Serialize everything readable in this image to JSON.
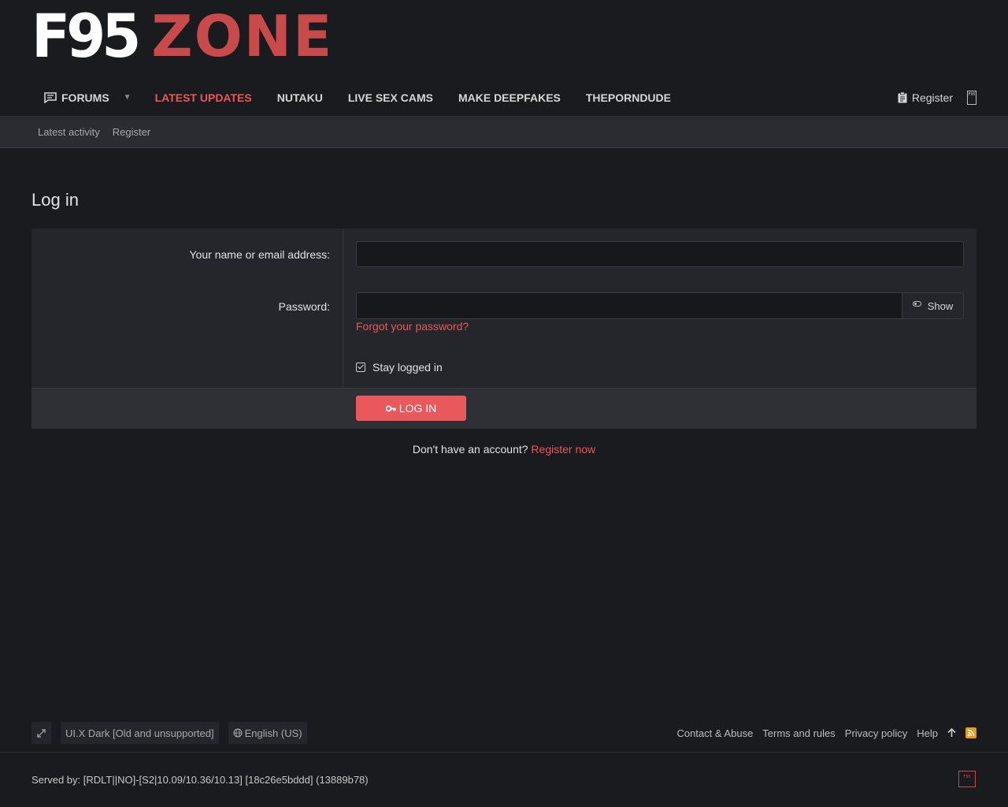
{
  "logo": {
    "part1": "F95",
    "part2": "ZONE"
  },
  "nav": {
    "items": [
      {
        "label": "FORUMS"
      },
      {
        "label": "LATEST UPDATES"
      },
      {
        "label": "NUTAKU"
      },
      {
        "label": "LIVE SEX CAMS"
      },
      {
        "label": "MAKE DEEPFAKES"
      },
      {
        "label": "THEPORNDUDE"
      }
    ],
    "register": "Register",
    "mini_logo": "F95"
  },
  "subnav": {
    "latest_activity": "Latest activity",
    "register": "Register"
  },
  "page": {
    "title": "Log in"
  },
  "form": {
    "name_label": "Your name or email address:",
    "name_value": "",
    "password_label": "Password:",
    "password_value": "",
    "show_label": "Show",
    "forgot": "Forgot your password?",
    "stay_logged_in": "Stay logged in",
    "submit": "LOG IN"
  },
  "register_prompt": {
    "text": "Don't have an account?",
    "link": "Register now"
  },
  "footer": {
    "style_chooser": "UI.X Dark [Old and unsupported]",
    "language": "English (US)",
    "links": [
      "Contact & Abuse",
      "Terms and rules",
      "Privacy policy",
      "Help"
    ],
    "served_by": "Served by: [RDLT||NO]-[S2|10.09/10.36/10.13] [18c26e5bddd] (13889b78)",
    "served_logo": "F95"
  },
  "colors": {
    "accent": "#e9585a",
    "background": "#1a1b1f",
    "panel": "#25262b",
    "rss": "#e89b17"
  },
  "icons": [
    "forums-icon",
    "register-clipboard-icon",
    "toggle-icon",
    "key-icon",
    "expand-icon",
    "globe-icon",
    "arrow-up-icon",
    "rss-icon"
  ]
}
